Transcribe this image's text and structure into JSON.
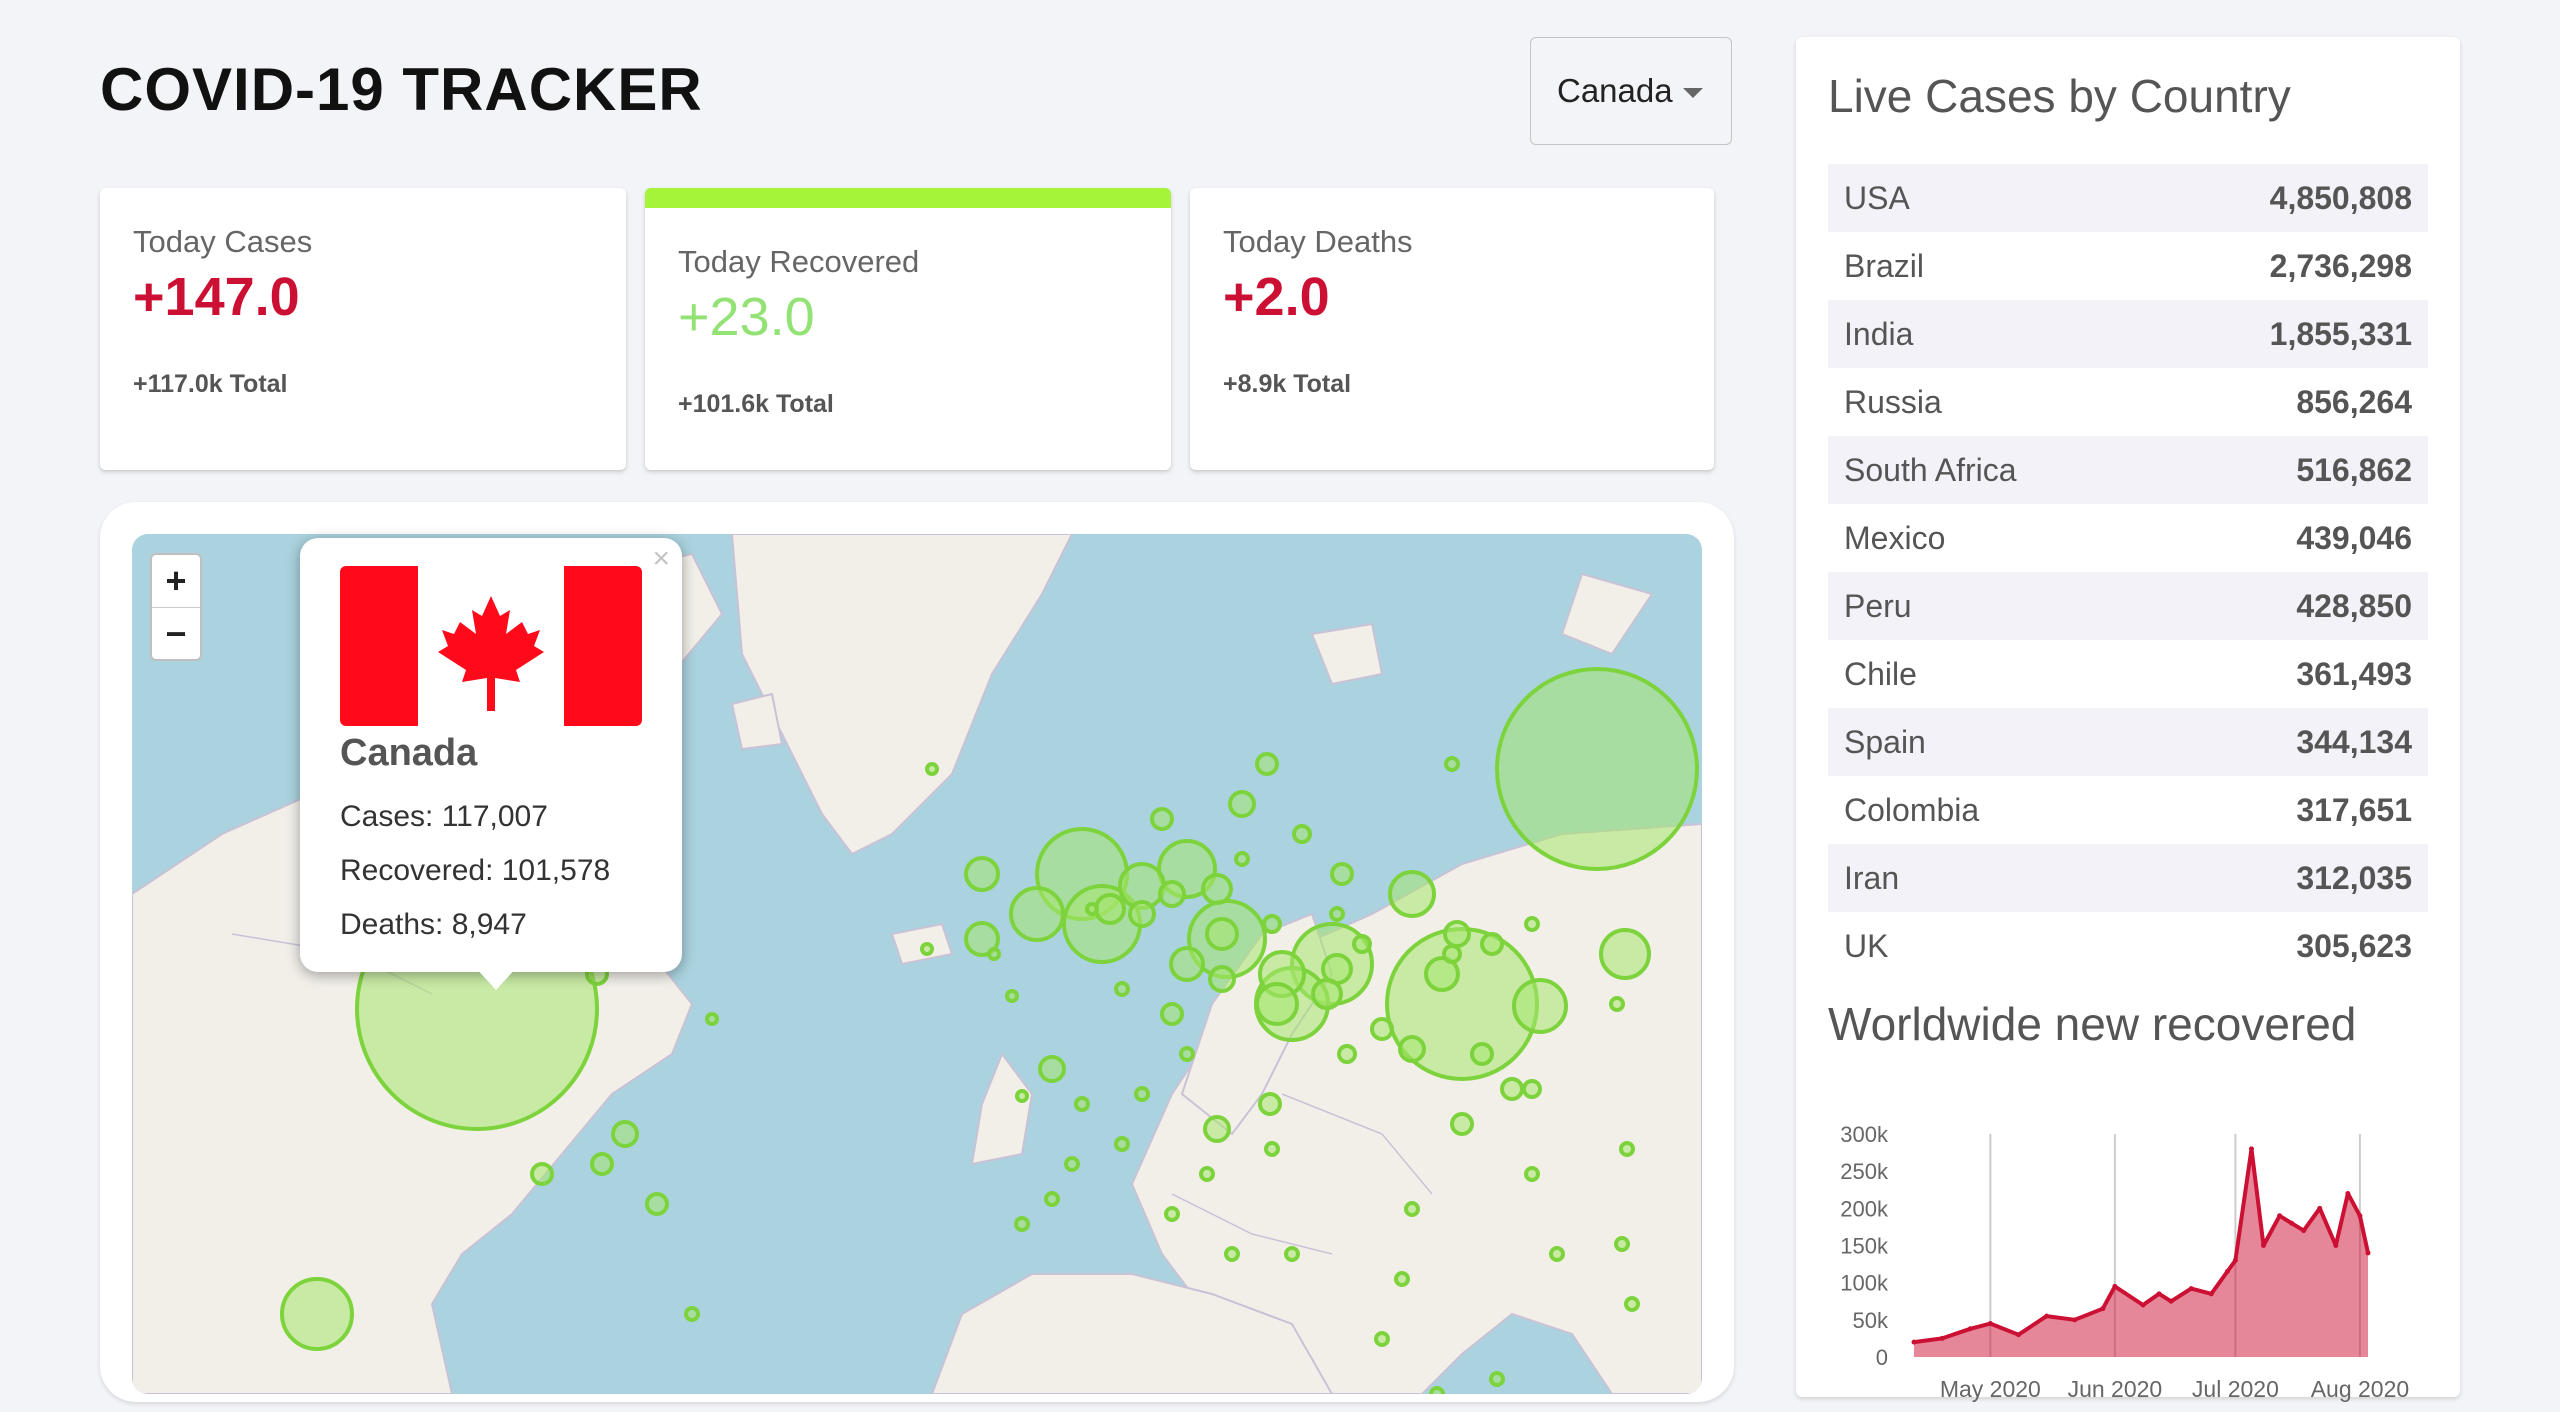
{
  "header": {
    "title": "COVID-19 TRACKER"
  },
  "country_select": {
    "selected": "Canada"
  },
  "stats": [
    {
      "label": "Today Cases",
      "value": "+147.0",
      "total": "+117.0k Total",
      "color": "#cc1034"
    },
    {
      "label": "Today Recovered",
      "value": "+23.0",
      "total": "+101.6k Total",
      "color": "#93e276",
      "active": true
    },
    {
      "label": "Today Deaths",
      "value": "+2.0",
      "total": "+8.9k Total",
      "color": "#cc1034"
    }
  ],
  "map": {
    "zoom_in": "+",
    "zoom_out": "−",
    "popup": {
      "close": "×",
      "country": "Canada",
      "cases": "Cases: 117,007",
      "recovered": "Recovered: 101,578",
      "deaths": "Deaths: 8,947"
    }
  },
  "sidebar": {
    "title": "Live Cases by Country",
    "countries": [
      {
        "name": "USA",
        "cases": "4,850,808"
      },
      {
        "name": "Brazil",
        "cases": "2,736,298"
      },
      {
        "name": "India",
        "cases": "1,855,331"
      },
      {
        "name": "Russia",
        "cases": "856,264"
      },
      {
        "name": "South Africa",
        "cases": "516,862"
      },
      {
        "name": "Mexico",
        "cases": "439,046"
      },
      {
        "name": "Peru",
        "cases": "428,850"
      },
      {
        "name": "Chile",
        "cases": "361,493"
      },
      {
        "name": "Spain",
        "cases": "344,134"
      },
      {
        "name": "Colombia",
        "cases": "317,651"
      },
      {
        "name": "Iran",
        "cases": "312,035"
      },
      {
        "name": "UK",
        "cases": "305,623"
      }
    ],
    "chart_title": "Worldwide new recovered"
  },
  "chart_data": {
    "type": "area",
    "title": "Worldwide new recovered",
    "xlabel": "",
    "ylabel": "",
    "ylim": [
      0,
      300000
    ],
    "yticks": [
      "0",
      "50k",
      "100k",
      "150k",
      "200k",
      "250k",
      "300k"
    ],
    "xticks": [
      "May 2020",
      "Jun 2020",
      "Jul 2020",
      "Aug 2020"
    ],
    "color": "#cc1034",
    "fill": "rgba(204,16,52,0.5)",
    "series": [
      {
        "x": [
          "2020-04-12",
          "2020-04-19",
          "2020-04-26",
          "2020-05-01",
          "2020-05-08",
          "2020-05-15",
          "2020-05-22",
          "2020-05-29",
          "2020-06-01",
          "2020-06-08",
          "2020-06-12",
          "2020-06-15",
          "2020-06-20",
          "2020-06-25",
          "2020-06-29",
          "2020-07-01",
          "2020-07-05",
          "2020-07-08",
          "2020-07-12",
          "2020-07-15",
          "2020-07-18",
          "2020-07-22",
          "2020-07-26",
          "2020-07-29",
          "2020-08-01",
          "2020-08-03"
        ],
        "values": [
          20000,
          25000,
          38000,
          45000,
          30000,
          55000,
          50000,
          65000,
          95000,
          70000,
          85000,
          75000,
          92000,
          85000,
          115000,
          130000,
          280000,
          150000,
          190000,
          180000,
          170000,
          200000,
          150000,
          220000,
          190000,
          140000
        ]
      }
    ]
  }
}
